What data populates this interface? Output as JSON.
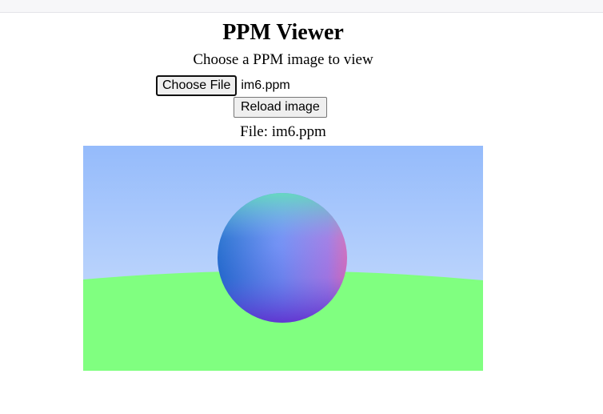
{
  "header": {
    "title": "PPM Viewer",
    "subtitle": "Choose a PPM image to view"
  },
  "file_input": {
    "button_label": "Choose File",
    "selected_file": "im6.ppm"
  },
  "reload_button": {
    "label": "Reload image"
  },
  "file_info": {
    "label": "File: im6.ppm"
  },
  "colors": {
    "sky_top": "#95bbfb",
    "sky_bottom": "#d2e3fd",
    "ground": "#80ff80"
  }
}
